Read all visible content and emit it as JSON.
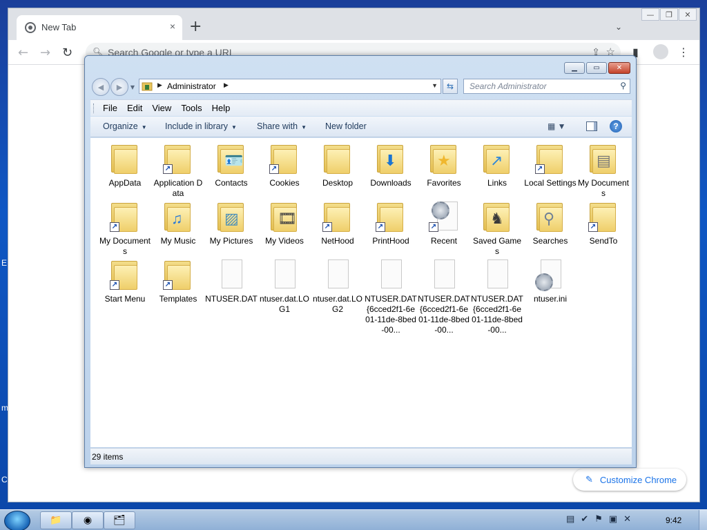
{
  "desktop": {
    "edge_chars": [
      "E",
      "m",
      "C"
    ]
  },
  "chrome": {
    "tab_title": "New Tab",
    "tab_close": "×",
    "new_tab": "+",
    "tab_search": "⌄",
    "omnibox_placeholder": "Search Google or type a URL",
    "customize_label": "Customize Chrome",
    "window_controls": [
      "—",
      "❐",
      "✕"
    ]
  },
  "explorer": {
    "breadcrumb": "Administrator",
    "search_placeholder": "Search Administrator",
    "menu": [
      "File",
      "Edit",
      "View",
      "Tools",
      "Help"
    ],
    "commands": {
      "organize": "Organize",
      "include_in_library": "Include in library",
      "share_with": "Share with",
      "new_folder": "New folder"
    },
    "items": [
      {
        "label": "AppData",
        "kind": "folder",
        "shortcut": false
      },
      {
        "label": "Application Data",
        "kind": "folder",
        "shortcut": true
      },
      {
        "label": "Contacts",
        "kind": "folder",
        "shortcut": false,
        "overlay": "contact-card"
      },
      {
        "label": "Cookies",
        "kind": "folder",
        "shortcut": true
      },
      {
        "label": "Desktop",
        "kind": "folder",
        "shortcut": false
      },
      {
        "label": "Downloads",
        "kind": "folder",
        "shortcut": false,
        "overlay": "download-arrow"
      },
      {
        "label": "Favorites",
        "kind": "folder",
        "shortcut": false,
        "overlay": "star"
      },
      {
        "label": "Links",
        "kind": "folder",
        "shortcut": false,
        "overlay": "link-arrow"
      },
      {
        "label": "Local Settings",
        "kind": "folder",
        "shortcut": true
      },
      {
        "label": "My Documents",
        "kind": "folder",
        "shortcut": false,
        "overlay": "document"
      },
      {
        "label": "My Documents",
        "kind": "folder",
        "shortcut": true
      },
      {
        "label": "My Music",
        "kind": "folder",
        "shortcut": false,
        "overlay": "music-note"
      },
      {
        "label": "My Pictures",
        "kind": "folder",
        "shortcut": false,
        "overlay": "picture"
      },
      {
        "label": "My Videos",
        "kind": "folder",
        "shortcut": false,
        "overlay": "film"
      },
      {
        "label": "NetHood",
        "kind": "folder",
        "shortcut": true
      },
      {
        "label": "PrintHood",
        "kind": "folder",
        "shortcut": true
      },
      {
        "label": "Recent",
        "kind": "recent",
        "shortcut": true
      },
      {
        "label": "Saved Games",
        "kind": "folder",
        "shortcut": false,
        "overlay": "chess"
      },
      {
        "label": "Searches",
        "kind": "folder",
        "shortcut": false,
        "overlay": "magnifier"
      },
      {
        "label": "SendTo",
        "kind": "folder",
        "shortcut": true
      },
      {
        "label": "Start Menu",
        "kind": "folder",
        "shortcut": true
      },
      {
        "label": "Templates",
        "kind": "folder",
        "shortcut": true
      },
      {
        "label": "NTUSER.DAT",
        "kind": "file",
        "shortcut": false
      },
      {
        "label": "ntuser.dat.LOG1",
        "kind": "file",
        "shortcut": false
      },
      {
        "label": "ntuser.dat.LOG2",
        "kind": "file",
        "shortcut": false
      },
      {
        "label": "NTUSER.DAT{6cced2f1-6e01-11de-8bed-00...",
        "kind": "file",
        "shortcut": false
      },
      {
        "label": "NTUSER.DAT{6cced2f1-6e01-11de-8bed-00...",
        "kind": "file",
        "shortcut": false
      },
      {
        "label": "NTUSER.DAT{6cced2f1-6e01-11de-8bed-00...",
        "kind": "file",
        "shortcut": false
      },
      {
        "label": "ntuser.ini",
        "kind": "ini",
        "shortcut": false
      }
    ],
    "status": "29 items"
  },
  "taskbar": {
    "clock": "9:42"
  },
  "colors": {
    "chrome_accent": "#1a73e8",
    "folder_yellow": "#efcf6a",
    "explorer_frame": "#bcd2eb"
  }
}
